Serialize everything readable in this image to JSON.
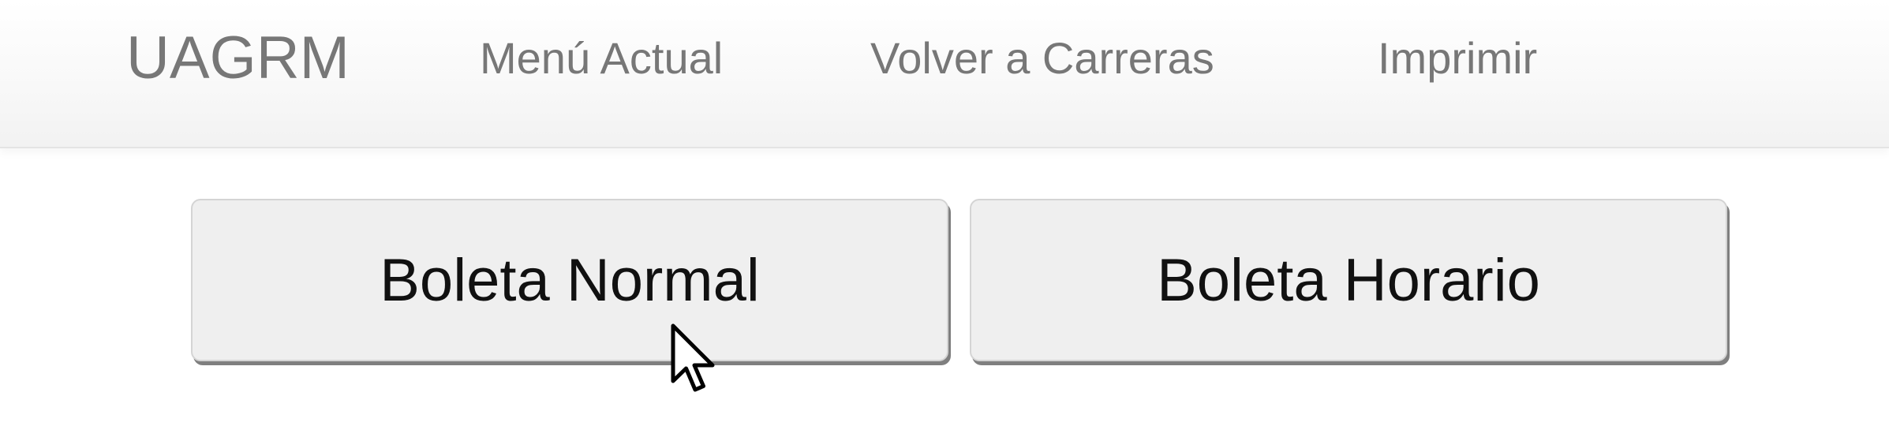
{
  "navbar": {
    "brand": "UAGRM",
    "links": [
      {
        "label": "Menú Actual"
      },
      {
        "label": "Volver a Carreras"
      },
      {
        "label": "Imprimir"
      }
    ]
  },
  "buttons": {
    "normal_label": "Boleta Normal",
    "horario_label": "Boleta Horario"
  },
  "colors": {
    "nav_text": "#777777",
    "button_bg": "#efefef",
    "button_text": "#111111"
  },
  "icons": {
    "cursor": "mouse-pointer-icon"
  }
}
